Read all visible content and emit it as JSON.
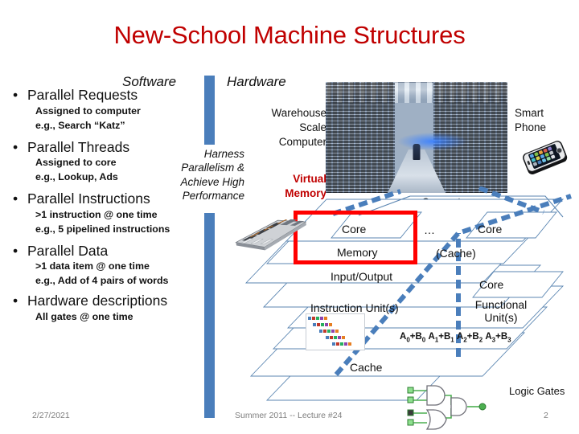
{
  "slide": {
    "title": "New-School Machine Structures",
    "title_color": "#C00000",
    "accent_blue": "#4A7EBB",
    "highlight_red": "#FF0000"
  },
  "columns": {
    "software_header": "Software",
    "hardware_header": "Hardware"
  },
  "bullets": [
    {
      "label": "Parallel Requests",
      "sublines": [
        "Assigned to computer",
        "e.g., Search “Katz”"
      ]
    },
    {
      "label": "Parallel Threads",
      "sublines": [
        "Assigned to core",
        "e.g., Lookup, Ads"
      ]
    },
    {
      "label": "Parallel Instructions",
      "sublines": [
        ">1 instruction @ one time",
        "e.g., 5 pipelined instructions"
      ]
    },
    {
      "label": "Parallel Data",
      "sublines": [
        ">1 data item @ one time",
        "e.g., Add of 4 pairs of words"
      ]
    },
    {
      "label": "Hardware descriptions",
      "sublines": [
        "All gates @ one time"
      ]
    }
  ],
  "harness": {
    "line1": "Harness",
    "line2": "Parallelism &",
    "line3": "Achieve High",
    "line4": "Performance"
  },
  "hardware_labels": {
    "warehouse_scale_computer": "Warehouse\nScale\nComputer",
    "wsc_line1": "Warehouse",
    "wsc_line2": "Scale",
    "wsc_line3": "Computer",
    "virtual_memory_line1": "Virtual",
    "virtual_memory_line2": "Memory",
    "smart_phone_line1": "Smart",
    "smart_phone_line2": "Phone",
    "computer": "Computer",
    "logic_gates": "Logic Gates"
  },
  "diagram": {
    "core_1": "Core",
    "ellipsis": "…",
    "core_2": "Core",
    "memory": "Memory",
    "cache_paren": "(Cache)",
    "input_output": "Input/Output",
    "core_3": "Core",
    "instruction_units": "Instruction Unit(s)",
    "functional_units_line1": "Functional",
    "functional_units_line2": "Unit(s)",
    "simd_ops": [
      {
        "a": "A",
        "asub": "0",
        "b": "B",
        "bsub": "0"
      },
      {
        "a": "A",
        "asub": "1",
        "b": "B",
        "bsub": "1"
      },
      {
        "a": "A",
        "asub": "2",
        "b": "B",
        "bsub": "2"
      },
      {
        "a": "A",
        "asub": "3",
        "b": "B",
        "bsub": "3"
      }
    ],
    "cache_bottom": "Cache"
  },
  "footer": {
    "date": "2/27/2021",
    "center": "Summer 2011 -- Lecture #24",
    "page": "2"
  },
  "icons": {
    "warehouse_photo": "datacenter-photo",
    "smartphone_photo": "smartphone-photo",
    "server_blade_photo": "server-blade-photo",
    "pipeline_photo": "pipeline-diagram-photo",
    "logic_gate_diagram": "logic-gate-diagram"
  }
}
